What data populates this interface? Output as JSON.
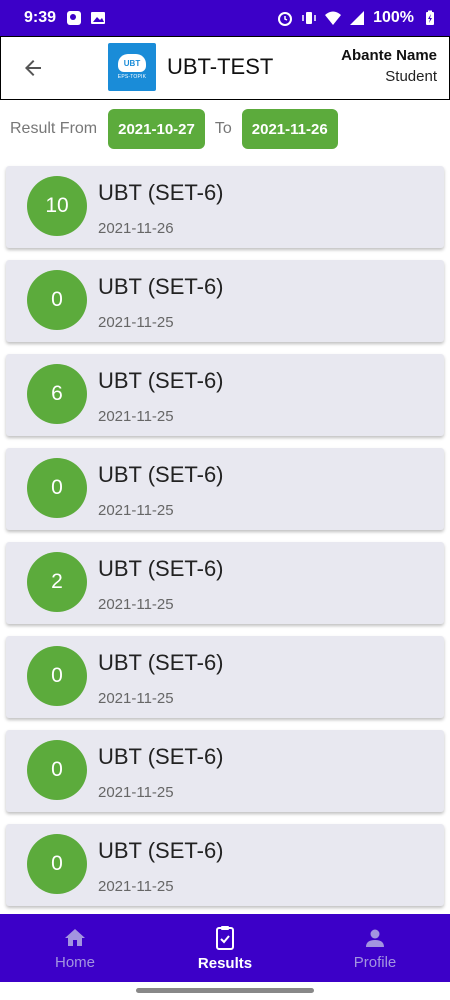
{
  "status_bar": {
    "time": "9:39",
    "battery": "100%"
  },
  "header": {
    "title": "UBT-TEST",
    "logo_text": "UBT",
    "logo_sub": "EPS-TOPIK",
    "user_name": "Abante Name",
    "user_role": "Student"
  },
  "filter": {
    "from_label": "Result From",
    "from_date": "2021-10-27",
    "to_label": "To",
    "to_date": "2021-11-26"
  },
  "results": [
    {
      "score": "10",
      "title": "UBT (SET-6)",
      "date": "2021-11-26"
    },
    {
      "score": "0",
      "title": "UBT (SET-6)",
      "date": "2021-11-25"
    },
    {
      "score": "6",
      "title": "UBT (SET-6)",
      "date": "2021-11-25"
    },
    {
      "score": "0",
      "title": "UBT (SET-6)",
      "date": "2021-11-25"
    },
    {
      "score": "2",
      "title": "UBT (SET-6)",
      "date": "2021-11-25"
    },
    {
      "score": "0",
      "title": "UBT (SET-6)",
      "date": "2021-11-25"
    },
    {
      "score": "0",
      "title": "UBT (SET-6)",
      "date": "2021-11-25"
    },
    {
      "score": "0",
      "title": "UBT (SET-6)",
      "date": "2021-11-25"
    }
  ],
  "nav": {
    "home": "Home",
    "results": "Results",
    "profile": "Profile"
  },
  "colors": {
    "primary": "#3c00c8",
    "accent_green": "#5cab3c",
    "card_bg": "#e8e8f0"
  }
}
